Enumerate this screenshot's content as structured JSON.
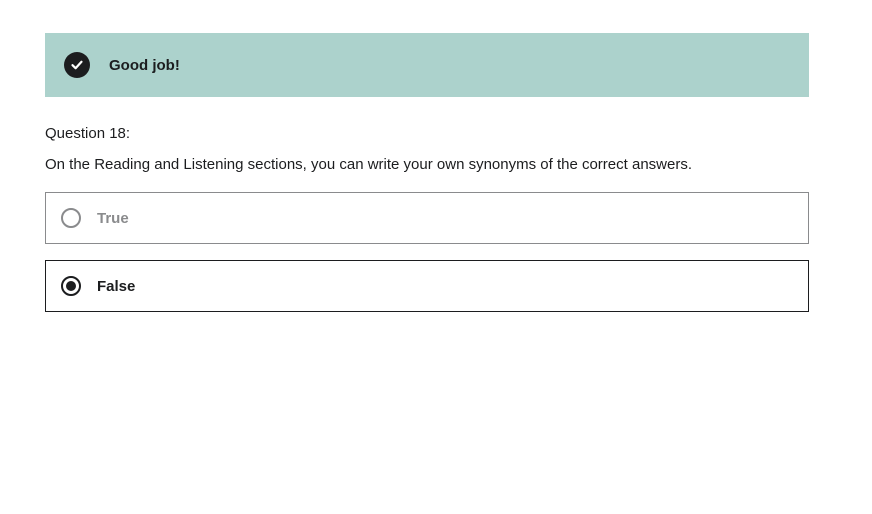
{
  "feedback": {
    "icon": "check-circle-icon",
    "message": "Good job!",
    "background_color": "#acd2cc"
  },
  "question": {
    "label": "Question 18:",
    "text": "On the Reading and Listening sections, you can write your own synonyms of the correct answers."
  },
  "options": [
    {
      "label": "True",
      "selected": false
    },
    {
      "label": "False",
      "selected": true
    }
  ]
}
